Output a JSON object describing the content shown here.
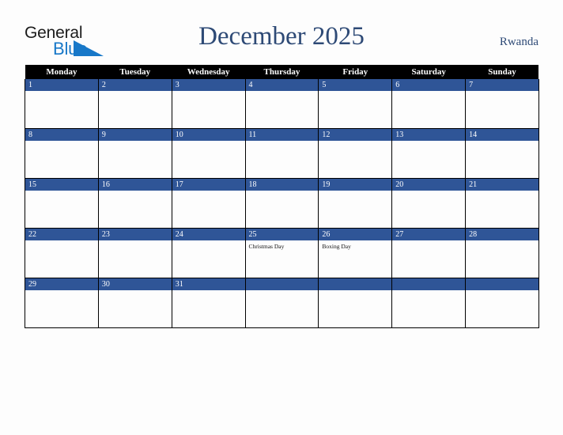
{
  "header": {
    "logo": {
      "text_primary": "General",
      "text_secondary": "Blue",
      "triangle_icon": "blue-triangle-icon",
      "primary_color": "#1b1b1b",
      "secondary_color": "#1878c8"
    },
    "title": "December 2025",
    "region": "Rwanda",
    "title_color": "#2e4a76"
  },
  "calendar": {
    "month": "December",
    "year": "2025",
    "first_day_of_week": "Monday",
    "header_background": "#000000",
    "header_text_color": "#ffffff",
    "daynum_background": "#2f5597",
    "daynum_text_color": "#ffffff",
    "cell_background": "#fdfdfd",
    "weekday_headers": [
      "Monday",
      "Tuesday",
      "Wednesday",
      "Thursday",
      "Friday",
      "Saturday",
      "Sunday"
    ],
    "weeks": [
      [
        {
          "day": "1",
          "events": []
        },
        {
          "day": "2",
          "events": []
        },
        {
          "day": "3",
          "events": []
        },
        {
          "day": "4",
          "events": []
        },
        {
          "day": "5",
          "events": []
        },
        {
          "day": "6",
          "events": []
        },
        {
          "day": "7",
          "events": []
        }
      ],
      [
        {
          "day": "8",
          "events": []
        },
        {
          "day": "9",
          "events": []
        },
        {
          "day": "10",
          "events": []
        },
        {
          "day": "11",
          "events": []
        },
        {
          "day": "12",
          "events": []
        },
        {
          "day": "13",
          "events": []
        },
        {
          "day": "14",
          "events": []
        }
      ],
      [
        {
          "day": "15",
          "events": []
        },
        {
          "day": "16",
          "events": []
        },
        {
          "day": "17",
          "events": []
        },
        {
          "day": "18",
          "events": []
        },
        {
          "day": "19",
          "events": []
        },
        {
          "day": "20",
          "events": []
        },
        {
          "day": "21",
          "events": []
        }
      ],
      [
        {
          "day": "22",
          "events": []
        },
        {
          "day": "23",
          "events": []
        },
        {
          "day": "24",
          "events": []
        },
        {
          "day": "25",
          "events": [
            "Christmas Day"
          ]
        },
        {
          "day": "26",
          "events": [
            "Boxing Day"
          ]
        },
        {
          "day": "27",
          "events": []
        },
        {
          "day": "28",
          "events": []
        }
      ],
      [
        {
          "day": "29",
          "events": []
        },
        {
          "day": "30",
          "events": []
        },
        {
          "day": "31",
          "events": []
        },
        {
          "day": "",
          "events": []
        },
        {
          "day": "",
          "events": []
        },
        {
          "day": "",
          "events": []
        },
        {
          "day": "",
          "events": []
        }
      ]
    ]
  }
}
